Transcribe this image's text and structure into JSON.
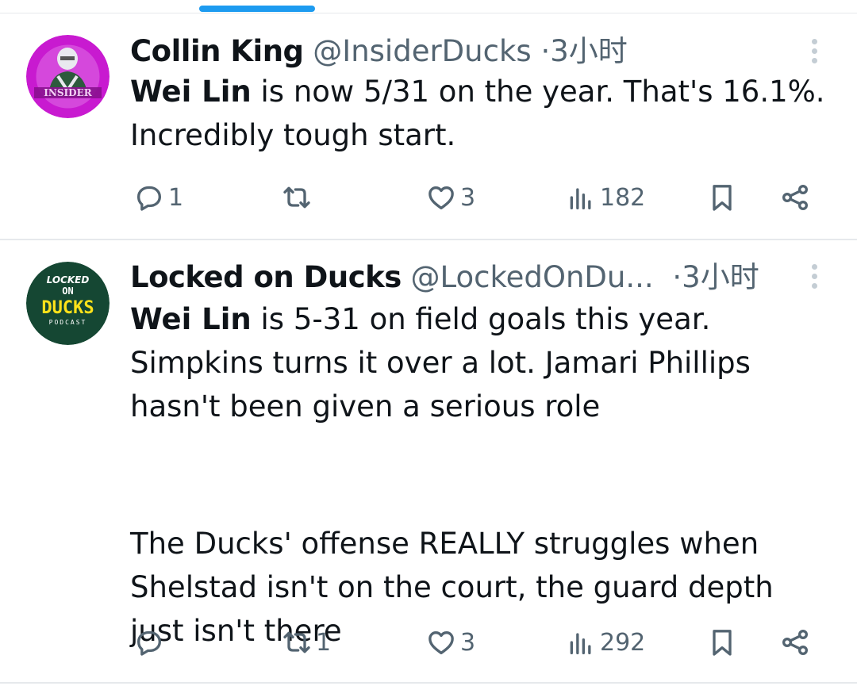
{
  "tweets": [
    {
      "avatar_label": "INSIDER",
      "name": "Collin King",
      "handle": "@InsiderDucks",
      "separator": "·",
      "time": "3小时",
      "lines": [
        {
          "bold": "Wei Lin",
          "rest": " is now 5/31 on the year. That's 16.1%."
        },
        {
          "bold": "",
          "rest": "Incredibly tough start."
        }
      ],
      "replies": "1",
      "retweets": "",
      "likes": "3",
      "views": "182"
    },
    {
      "avatar_label": {
        "top": "LOCKED",
        "mid": "ON",
        "main": "DUCKS",
        "sub": "PODCAST"
      },
      "name": "Locked on Ducks",
      "handle": "@LockedOnDu...",
      "separator": "·",
      "time": "3小时",
      "paragraph1": [
        {
          "bold": "Wei Lin",
          "rest": " is 5-31 on field goals this year."
        },
        {
          "bold": "",
          "rest": "Simpkins turns it over a lot. Jamari Phillips"
        },
        {
          "bold": "",
          "rest": "hasn't been given a serious role"
        }
      ],
      "paragraph2": [
        "The Ducks' offense REALLY struggles when",
        "Shelstad isn't on the court, the guard depth",
        "just isn't there"
      ],
      "replies": "",
      "retweets": "1",
      "likes": "3",
      "views": "292"
    }
  ],
  "icons": [
    "reply-icon",
    "retweet-icon",
    "like-icon",
    "views-icon",
    "bookmark-icon",
    "share-icon",
    "more-icon"
  ],
  "colors": {
    "accent": "#1d9bf0",
    "text": "#0f1419",
    "secondary": "#536471",
    "insider_avatar": "#c81ad0",
    "ducks_avatar": "#154733",
    "ducks_yellow": "#fee11a"
  }
}
